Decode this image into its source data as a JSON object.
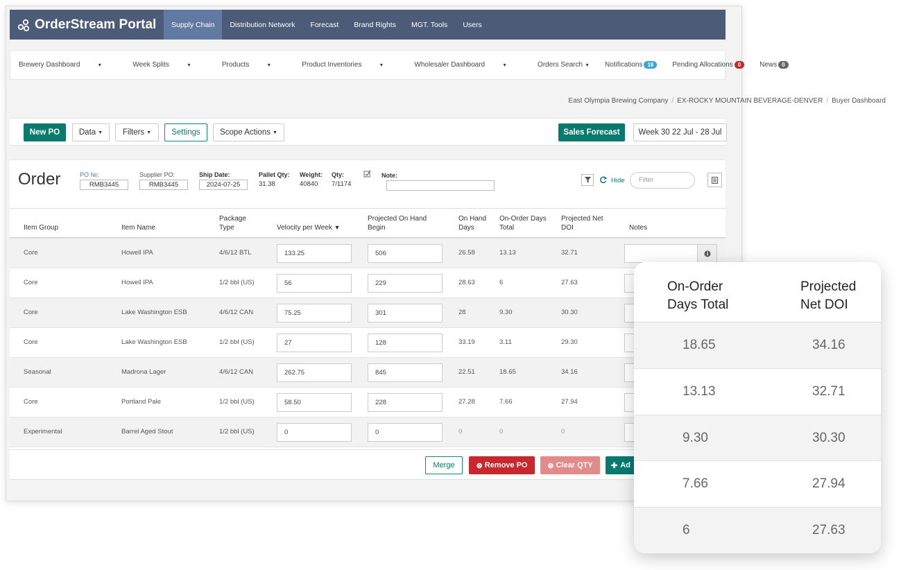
{
  "app": {
    "title": "OrderStream Portal",
    "nav": [
      "Supply Chain",
      "Distribution Network",
      "Forecast",
      "Brand Rights",
      "MGT. Tools",
      "Users"
    ]
  },
  "subnav": {
    "left": [
      "Brewery Dashboard",
      "Week Splits",
      "Products",
      "Product Inventories",
      "Wholesaler Dashboard"
    ],
    "orders_search": "Orders Search",
    "notifications": "Notifications",
    "notifications_count": "18",
    "pending": "Pending Allocations",
    "pending_count": "0",
    "news": "News",
    "news_count": "0"
  },
  "breadcrumb": [
    "East Olympia Brewing Company",
    "EX-ROCKY MOUNTAIN BEVERAGE-DENVER",
    "Buyer Dashboard"
  ],
  "toolbar": {
    "new_po": "New PO",
    "data": "Data",
    "filters": "Filters",
    "settings": "Settings",
    "scope_actions": "Scope Actions",
    "sales_forecast": "Sales Forecast",
    "week": "Week 30 22 Jul - 28 Jul"
  },
  "order": {
    "title": "Order",
    "po_label": "PO №:",
    "po_value": "RMB3445",
    "supplier_label": "Supplier PO:",
    "supplier_value": "RMB3445",
    "ship_label": "Ship Date:",
    "ship_value": "2024-07-25",
    "pallet_label": "Pallet Qty:",
    "pallet_value": "31.38",
    "weight_label": "Weight:",
    "weight_value": "40840",
    "qty_label": "Qty:",
    "qty_value": "7/1174",
    "note_label": "Note:",
    "hide": "Hide",
    "filter_placeholder": "Filter"
  },
  "table": {
    "headers": {
      "item_group": "Item Group",
      "item_name": "Item Name",
      "package_1": "Package",
      "package_2": "Type",
      "velocity": "Velocity per Week",
      "projected_1": "Projected On Hand",
      "projected_2": "Begin",
      "onhand_1": "On Hand",
      "onhand_2": "Days",
      "onorder_1": "On-Order Days",
      "onorder_2": "Total",
      "net_1": "Projected Net",
      "net_2": "DOI",
      "notes": "Notes"
    },
    "rows": [
      {
        "group": "Core",
        "name": "Howell IPA",
        "pkg": "4/6/12 BTL",
        "velocity": "133.25",
        "projected": "506",
        "onhand": "26.58",
        "onorder": "13.13",
        "net": "32.71"
      },
      {
        "group": "Core",
        "name": "Howell IPA",
        "pkg": "1/2 bbl (US)",
        "velocity": "56",
        "projected": "229",
        "onhand": "28.63",
        "onorder": "6",
        "net": "27.63"
      },
      {
        "group": "Core",
        "name": "Lake Washington ESB",
        "pkg": "4/6/12 CAN",
        "velocity": "75.25",
        "projected": "301",
        "onhand": "28",
        "onorder": "9.30",
        "net": "30.30"
      },
      {
        "group": "Core",
        "name": "Lake Washington ESB",
        "pkg": "1/2 bbl (US)",
        "velocity": "27",
        "projected": "128",
        "onhand": "33.19",
        "onorder": "3.11",
        "net": "29.30"
      },
      {
        "group": "Seasonal",
        "name": "Madrona Lager",
        "pkg": "4/6/12 CAN",
        "velocity": "262.75",
        "projected": "845",
        "onhand": "22.51",
        "onorder": "18.65",
        "net": "34.16"
      },
      {
        "group": "Core",
        "name": "Portland Pale",
        "pkg": "1/2 bbl (US)",
        "velocity": "58.50",
        "projected": "228",
        "onhand": "27.28",
        "onorder": "7.66",
        "net": "27.94"
      },
      {
        "group": "Experimental",
        "name": "Barrel Aged Stout",
        "pkg": "1/2 bbl (US)",
        "velocity": "0",
        "projected": "0",
        "onhand": "0",
        "onorder": "0",
        "net": "0"
      }
    ]
  },
  "footer": {
    "merge": "Merge",
    "remove_po": "Remove PO",
    "clear_qty": "Clear QTY",
    "add": "Ad"
  },
  "popup": {
    "head_left_1": "On-Order",
    "head_left_2": "Days Total",
    "head_right_1": "Projected",
    "head_right_2": "Net DOI",
    "rows": [
      {
        "left": "18.65",
        "right": "34.16"
      },
      {
        "left": "13.13",
        "right": "32.71"
      },
      {
        "left": "9.30",
        "right": "30.30"
      },
      {
        "left": "7.66",
        "right": "27.94"
      },
      {
        "left": "6",
        "right": "27.63"
      }
    ]
  },
  "colors": {
    "nav_bg": "#4c5c78",
    "nav_active": "#6279a3",
    "primary_teal": "#087a6e",
    "danger_red": "#c8272d",
    "light_red": "#e38a8a",
    "badge_blue": "#3aa6d8"
  }
}
